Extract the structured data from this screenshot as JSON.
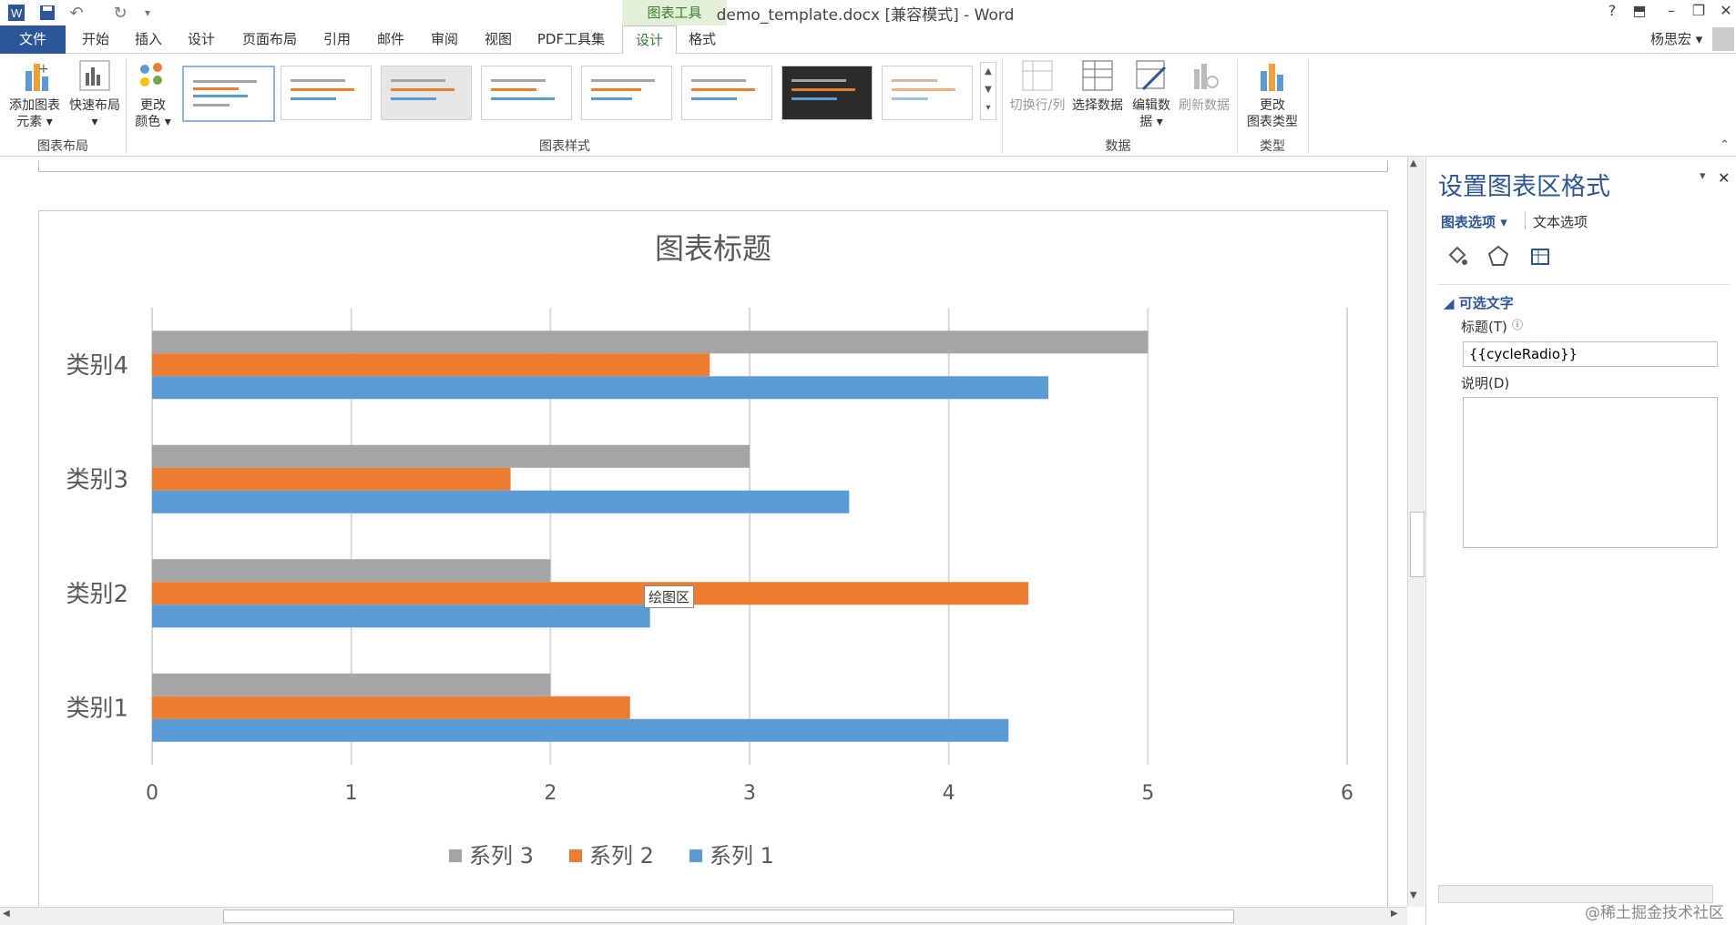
{
  "window": {
    "document_title": "demo_template.docx [兼容模式] - Word",
    "context_tab_group": "图表工具",
    "user_name": "杨思宏"
  },
  "tabs": [
    "开始",
    "插入",
    "设计",
    "页面布局",
    "引用",
    "邮件",
    "审阅",
    "视图",
    "PDF工具集"
  ],
  "file_tab": "文件",
  "context_tabs": {
    "design": "设计",
    "format": "格式"
  },
  "ribbon": {
    "add_element": [
      "添加图表",
      "元素 ▾"
    ],
    "quick_layout": "快速布局",
    "change_color": [
      "更改",
      "颜色 ▾"
    ],
    "group_layout": "图表布局",
    "group_styles": "图表样式",
    "switch_row_col": "切换行/列",
    "select_data": "选择数据",
    "edit_data": [
      "编辑数",
      "据 ▾"
    ],
    "refresh_data": "刷新数据",
    "group_data": "数据",
    "change_type": [
      "更改",
      "图表类型"
    ],
    "group_type": "类型"
  },
  "chart_data": {
    "type": "bar",
    "orientation": "horizontal",
    "title": "图表标题",
    "categories": [
      "类别1",
      "类别2",
      "类别3",
      "类别4"
    ],
    "series": [
      {
        "name": "系列 1",
        "color": "#5b9bd5",
        "values": [
          4.3,
          2.5,
          3.5,
          4.5
        ]
      },
      {
        "name": "系列 2",
        "color": "#ed7d31",
        "values": [
          2.4,
          4.4,
          1.8,
          2.8
        ]
      },
      {
        "name": "系列 3",
        "color": "#a5a5a5",
        "values": [
          2,
          2,
          3,
          5
        ]
      }
    ],
    "xlim": [
      0,
      6
    ],
    "xticks": [
      "0",
      "1",
      "2",
      "3",
      "4",
      "5",
      "6"
    ],
    "grid": true,
    "legend_position": "bottom",
    "tooltip": "绘图区"
  },
  "pane": {
    "title": "设置图表区格式",
    "tab_chart_options": "图表选项 ▾",
    "tab_text_options": "文本选项",
    "section_alt_text": "◢ 可选文字",
    "label_title": "标题(T)",
    "title_value": "{{cycleRadio}}",
    "label_description": "说明(D)",
    "description_value": ""
  },
  "watermark": "@稀土掘金技术社区"
}
